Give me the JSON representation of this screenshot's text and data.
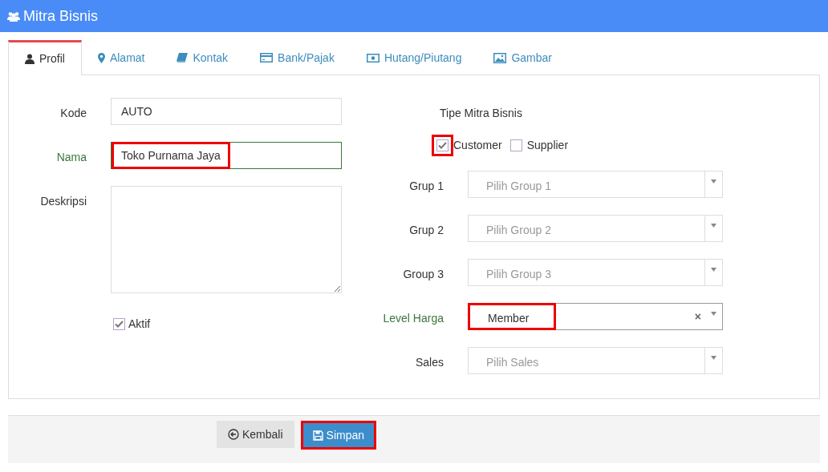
{
  "header": {
    "title": "Mitra Bisnis"
  },
  "tabs": [
    {
      "label": "Profil",
      "kind": "user",
      "selected": true
    },
    {
      "label": "Alamat",
      "kind": "pin",
      "selected": false
    },
    {
      "label": "Kontak",
      "kind": "book",
      "selected": false
    },
    {
      "label": "Bank/Pajak",
      "kind": "card",
      "selected": false
    },
    {
      "label": "Hutang/Piutang",
      "kind": "money",
      "selected": false
    },
    {
      "label": "Gambar",
      "kind": "image",
      "selected": false
    }
  ],
  "left_fields": [
    {
      "kind": "text",
      "label": "Kode",
      "value": "AUTO",
      "valid": false,
      "highlighted": false
    },
    {
      "kind": "text",
      "label": "Nama",
      "value": "Toko Purnama Jaya",
      "valid": true,
      "highlighted": true
    },
    {
      "kind": "textarea",
      "label": "Deskripsi",
      "valid": false,
      "highlighted": false
    }
  ],
  "aktif": {
    "label": "Aktif",
    "checked": true
  },
  "tipe": {
    "label": "Tipe Mitra Bisnis",
    "options": [
      {
        "label": "Customer",
        "checked": true,
        "highlighted": true
      },
      {
        "label": "Supplier",
        "checked": false,
        "highlighted": false
      }
    ]
  },
  "selects": [
    {
      "label": "Grup 1",
      "placeholder": "Pilih Group 1",
      "valid": false,
      "highlighted": false
    },
    {
      "label": "Grup 2",
      "placeholder": "Pilih Group 2",
      "valid": false,
      "highlighted": false
    },
    {
      "label": "Group 3",
      "placeholder": "Pilih Group 3",
      "valid": false,
      "highlighted": false
    },
    {
      "label": "Level Harga",
      "value": "Member",
      "clear": "×",
      "valid": true,
      "highlighted": true
    },
    {
      "label": "Sales",
      "placeholder": "Pilih Sales",
      "valid": false,
      "highlighted": false
    }
  ],
  "buttons": [
    {
      "kind": "back",
      "label": "Kembali",
      "highlighted": false
    },
    {
      "kind": "save",
      "label": "Simpan",
      "highlighted": true
    }
  ]
}
